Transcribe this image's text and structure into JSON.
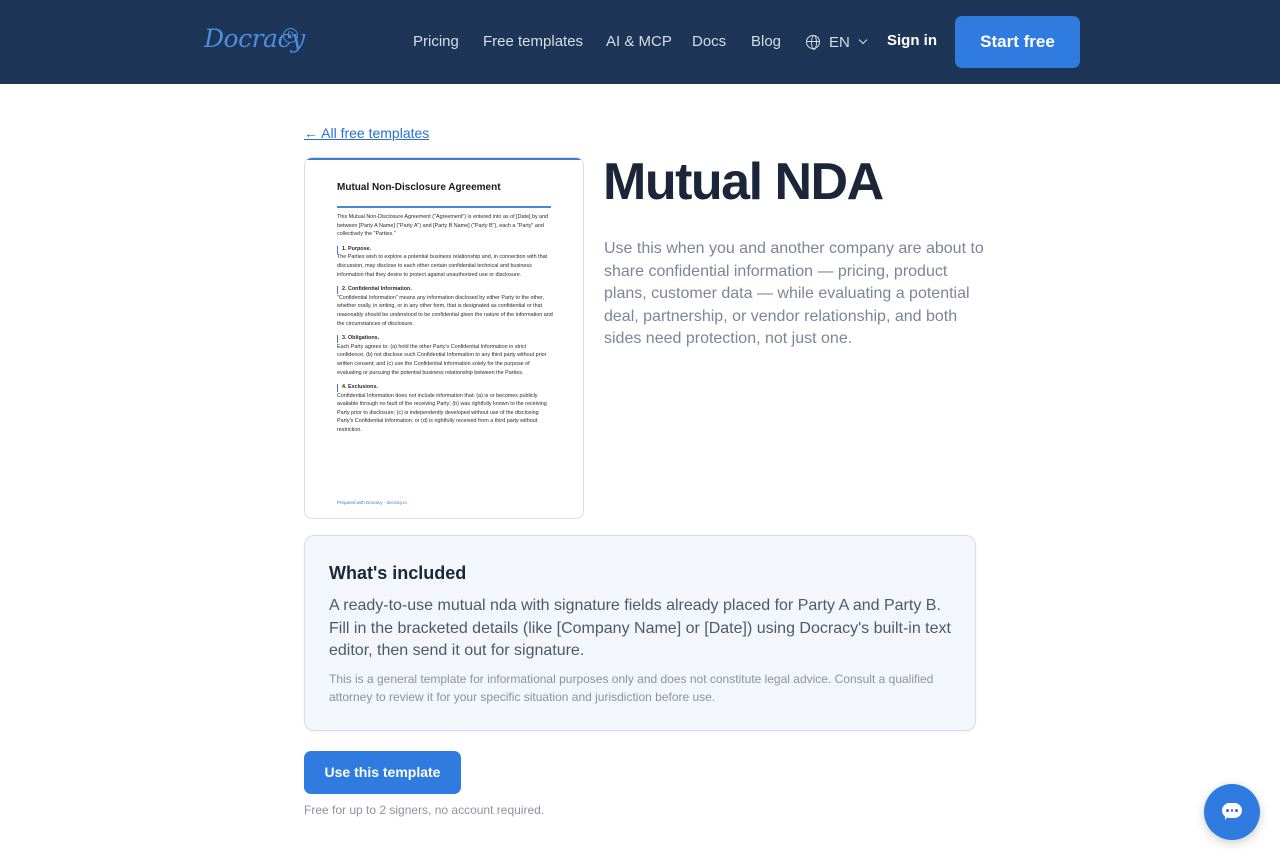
{
  "header": {
    "logo_text": "Docracy",
    "logo_badge": "D",
    "nav": [
      "Pricing",
      "Free templates",
      "AI & MCP",
      "Docs",
      "Blog"
    ],
    "language": "EN",
    "sign_in": "Sign in",
    "start_free": "Start free"
  },
  "back_link": "← All free templates",
  "preview": {
    "title": "Mutual Non-Disclosure Agreement",
    "intro": "This Mutual Non-Disclosure Agreement (\"Agreement\") is entered into as of [Date] by and between [Party A Name] (\"Party A\") and [Party B Name] (\"Party B\"), each a \"Party\" and collectively the \"Parties.\"",
    "sections": [
      {
        "heading": "1. Purpose.",
        "text": "The Parties wish to explore a potential business relationship and, in connection with that discussion, may disclose to each other certain confidential technical and business information that they desire to protect against unauthorized use or disclosure."
      },
      {
        "heading": "2. Confidential Information.",
        "text": "\"Confidential Information\" means any information disclosed by either Party to the other, whether orally, in writing, or in any other form, that is designated as confidential or that reasonably should be understood to be confidential given the nature of the information and the circumstances of disclosure."
      },
      {
        "heading": "3. Obligations.",
        "text": "Each Party agrees to: (a) hold the other Party's Confidential Information in strict confidence; (b) not disclose such Confidential Information to any third party without prior written consent; and (c) use the Confidential Information solely for the purpose of evaluating or pursuing the potential business relationship between the Parties."
      },
      {
        "heading": "4. Exclusions.",
        "text": "Confidential Information does not include information that: (a) is or becomes publicly available through no fault of the receiving Party; (b) was rightfully known to the receiving Party prior to disclosure; (c) is independently developed without use of the disclosing Party's Confidential Information; or (d) is rightfully received from a third party without restriction."
      }
    ],
    "footer": "Prepared with Docracy · docracy.io"
  },
  "title": "Mutual NDA",
  "description": "Use this when you and another company are about to share confidential information — pricing, product plans, customer data — while evaluating a potential deal, partnership, or vendor relationship, and both sides need protection, not just one.",
  "included": {
    "heading": "What's included",
    "text": "A ready-to-use mutual nda with signature fields already placed for Party A and Party B. Fill in the bracketed details (like [Company Name] or [Date]) using Docracy's built-in text editor, then send it out for signature.",
    "disclaimer": "This is a general template for informational purposes only and does not constitute legal advice. Consult a qualified attorney to review it for your specific situation and jurisdiction before use."
  },
  "cta": {
    "button": "Use this template",
    "note": "Free for up to 2 signers, no account required."
  },
  "icons": {
    "globe": "globe-icon",
    "chevron": "chevron-down-icon",
    "chat": "chat-bubble-icon"
  },
  "colors": {
    "header_bg": "#1d3557",
    "accent": "#2f7be0"
  }
}
